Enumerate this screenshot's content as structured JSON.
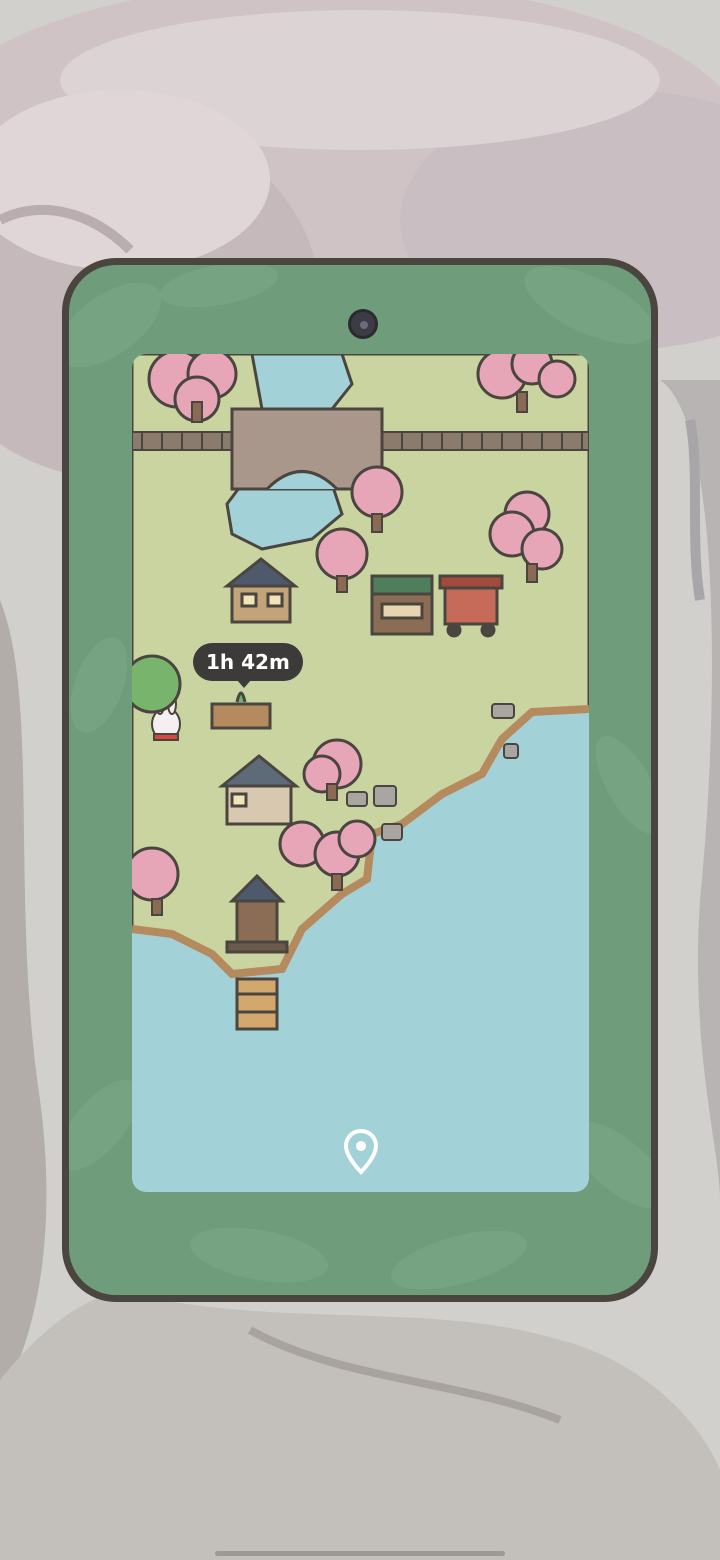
{
  "colors": {
    "phone_body": "#6f9d7b",
    "phone_outline": "#4b4540",
    "water": "#a2d2d8",
    "grass": "#c9d4a0",
    "cherry_blossom": "#e6a6b8",
    "timer_bubble": "#3c3b39"
  },
  "icons": {
    "location": "location-pin-icon",
    "camera": "camera-icon"
  },
  "map": {
    "farm_timer": "1h 42m"
  }
}
